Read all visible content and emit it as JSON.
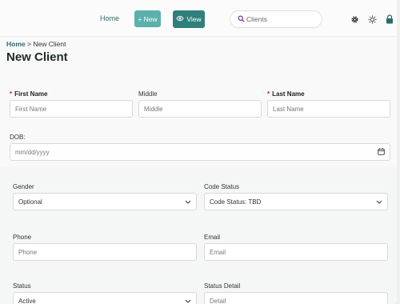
{
  "nav": {
    "home": "Home",
    "new": "+ New",
    "view": "View"
  },
  "search": {
    "placeholder": "Clients"
  },
  "breadcrumb": {
    "home": "Home",
    "separator": ">",
    "current": "New Client"
  },
  "page": {
    "title": "New Client"
  },
  "form": {
    "first_name": {
      "label": "First Name",
      "placeholder": "First Name",
      "required": true
    },
    "middle": {
      "label": "Middle",
      "placeholder": "Middle"
    },
    "last_name": {
      "label": "Last Name",
      "placeholder": "Last Name",
      "required": true
    },
    "dob": {
      "label": "DOB:",
      "placeholder": "mm/dd/yyyy"
    },
    "gender": {
      "label": "Gender",
      "value": "Optional"
    },
    "code_status": {
      "label": "Code Status",
      "value": "Code Status: TBD"
    },
    "phone": {
      "label": "Phone",
      "placeholder": "Phone"
    },
    "email": {
      "label": "Email",
      "placeholder": "Email"
    },
    "status": {
      "label": "Status",
      "value": "Active"
    },
    "status_detail": {
      "label": "Status Detail",
      "placeholder": "Detail"
    }
  },
  "icons": {
    "view": "eye-icon",
    "search": "search-icon",
    "settings": "gear-icon",
    "theme": "sun-icon",
    "lock": "lock-icon",
    "calendar": "calendar-icon",
    "dropdown": "chevron-down-icon"
  },
  "colors": {
    "accent": "#2f7f7b",
    "accent_light": "#5bb0ac",
    "required": "#c0282e"
  }
}
